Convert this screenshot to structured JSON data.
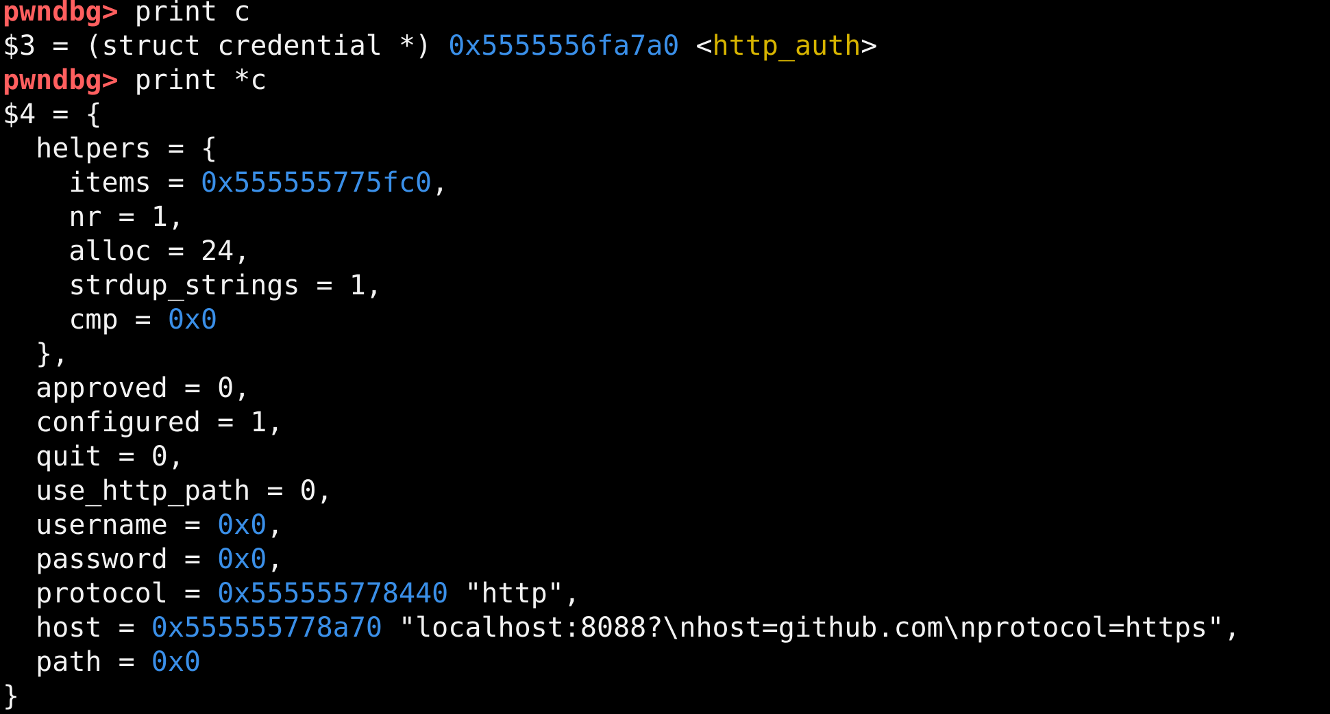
{
  "terminal": {
    "prompt": "pwndbg>",
    "colors": {
      "background": "#000000",
      "text": "#f2f2f2",
      "prompt": "#ff5f5f",
      "address": "#3a8fe8",
      "symbol": "#d7b400"
    },
    "lines": [
      [
        {
          "t": "prompt",
          "v": "pwndbg>"
        },
        {
          "t": "text",
          "v": " print c"
        }
      ],
      [
        {
          "t": "text",
          "v": "$3 = (struct credential *) "
        },
        {
          "t": "addr",
          "v": "0x5555556fa7a0"
        },
        {
          "t": "text",
          "v": " <"
        },
        {
          "t": "sym",
          "v": "http_auth"
        },
        {
          "t": "text",
          "v": ">"
        }
      ],
      [
        {
          "t": "prompt",
          "v": "pwndbg>"
        },
        {
          "t": "text",
          "v": " print *c"
        }
      ],
      [
        {
          "t": "text",
          "v": "$4 = {"
        }
      ],
      [
        {
          "t": "text",
          "v": "  helpers = {"
        }
      ],
      [
        {
          "t": "text",
          "v": "    items = "
        },
        {
          "t": "addr",
          "v": "0x555555775fc0"
        },
        {
          "t": "text",
          "v": ","
        }
      ],
      [
        {
          "t": "text",
          "v": "    nr = 1,"
        }
      ],
      [
        {
          "t": "text",
          "v": "    alloc = 24,"
        }
      ],
      [
        {
          "t": "text",
          "v": "    strdup_strings = 1,"
        }
      ],
      [
        {
          "t": "text",
          "v": "    cmp = "
        },
        {
          "t": "addr",
          "v": "0x0"
        }
      ],
      [
        {
          "t": "text",
          "v": "  },"
        }
      ],
      [
        {
          "t": "text",
          "v": "  approved = 0,"
        }
      ],
      [
        {
          "t": "text",
          "v": "  configured = 1,"
        }
      ],
      [
        {
          "t": "text",
          "v": "  quit = 0,"
        }
      ],
      [
        {
          "t": "text",
          "v": "  use_http_path = 0,"
        }
      ],
      [
        {
          "t": "text",
          "v": "  username = "
        },
        {
          "t": "addr",
          "v": "0x0"
        },
        {
          "t": "text",
          "v": ","
        }
      ],
      [
        {
          "t": "text",
          "v": "  password = "
        },
        {
          "t": "addr",
          "v": "0x0"
        },
        {
          "t": "text",
          "v": ","
        }
      ],
      [
        {
          "t": "text",
          "v": "  protocol = "
        },
        {
          "t": "addr",
          "v": "0x555555778440"
        },
        {
          "t": "text",
          "v": " \"http\","
        }
      ],
      [
        {
          "t": "text",
          "v": "  host = "
        },
        {
          "t": "addr",
          "v": "0x555555778a70"
        },
        {
          "t": "text",
          "v": " \"localhost:8088?\\nhost=github.com\\nprotocol=https\","
        }
      ],
      [
        {
          "t": "text",
          "v": "  path = "
        },
        {
          "t": "addr",
          "v": "0x0"
        }
      ],
      [
        {
          "t": "text",
          "v": "}"
        }
      ]
    ]
  }
}
